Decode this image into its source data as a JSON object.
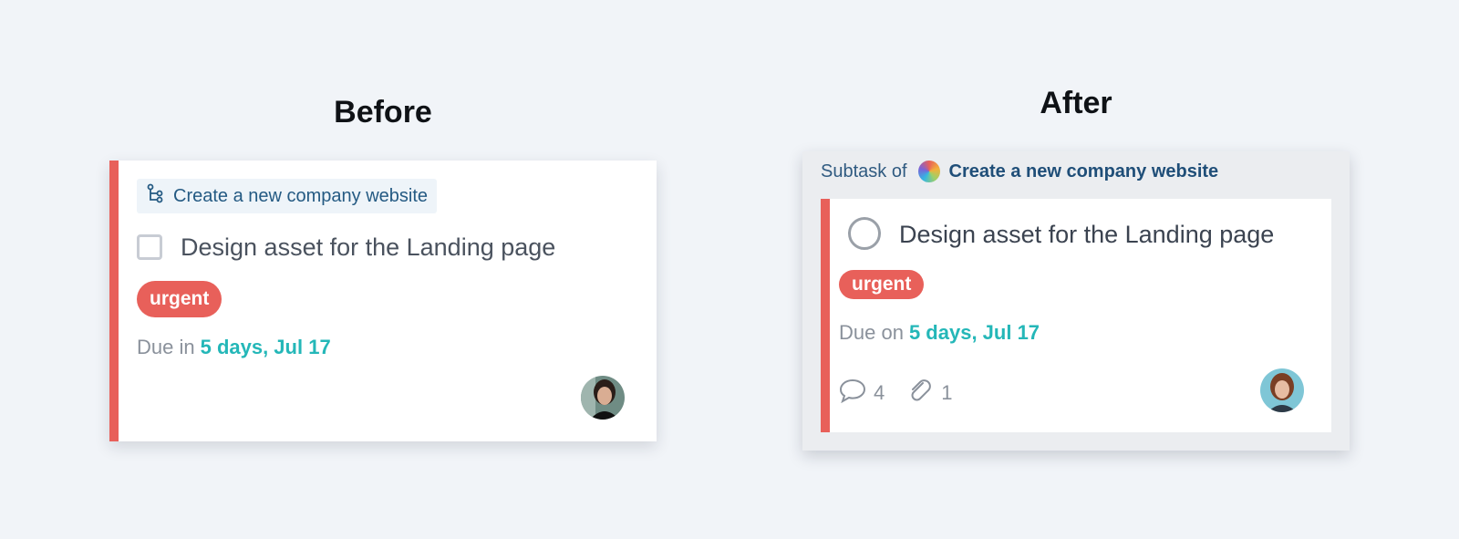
{
  "headings": {
    "before": "Before",
    "after": "After"
  },
  "before_card": {
    "parent_task": "Create a new company website",
    "title": "Design asset for the Landing page",
    "tag": "urgent",
    "due_label": "Due in",
    "due_value": "5 days, Jul 17"
  },
  "after_card": {
    "subtask_label": "Subtask of",
    "parent_task": "Create a new company website",
    "title": "Design asset for the Landing page",
    "tag": "urgent",
    "due_label": "Due on",
    "due_value": "5 days, Jul 17",
    "comments_count": "4",
    "attachments_count": "1"
  },
  "colors": {
    "accent_red": "#e8605a",
    "due_teal": "#24b7b8",
    "link_blue": "#245a83",
    "background": "#f1f4f8"
  },
  "icons": {
    "parent_chip": "subtask-tree-icon",
    "comments": "speech-bubble-icon",
    "attachments": "paperclip-icon",
    "project": "color-wheel-icon"
  }
}
